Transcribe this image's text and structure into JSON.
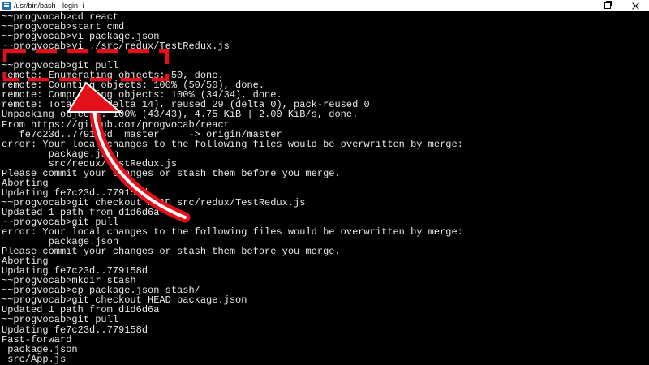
{
  "window": {
    "title": "/usr/bin/bash --login -i"
  },
  "terminal": {
    "lines": [
      "~~progvocab>cd react",
      "~~progvocab>start cmd",
      "~~progvocab>vi package.json",
      "~~progvocab>vi ./src/redux/TestRedux.js",
      "",
      "~~progvocab>git pull",
      "remote: Enumerating objects: 50, done.",
      "remote: Counting objects: 100% (50/50), done.",
      "remote: Compressing objects: 100% (34/34), done.",
      "remote: Total 43 (delta 14), reused 29 (delta 0), pack-reused 0",
      "Unpacking objects: 100% (43/43), 4.75 KiB | 2.00 KiB/s, done.",
      "From https://github.com/progvocab/react",
      "   fe7c23d..779158d  master     -> origin/master",
      "error: Your local changes to the following files would be overwritten by merge:",
      "        package.json",
      "        src/redux/TestRedux.js",
      "Please commit your changes or stash them before you merge.",
      "Aborting",
      "Updating fe7c23d..779158d",
      "~~progvocab>git checkout HEAD src/redux/TestRedux.js",
      "Updated 1 path from d1d6d6a",
      "~~progvocab>git pull",
      "error: Your local changes to the following files would be overwritten by merge:",
      "        package.json",
      "Please commit your changes or stash them before you merge.",
      "Aborting",
      "Updating fe7c23d..779158d",
      "~~progvocab>mkdir stash",
      "~~progvocab>cp package.json stash/",
      "~~progvocab>git checkout HEAD package.json",
      "Updated 1 path from d1d6d6a",
      "~~progvocab>git pull",
      "Updating fe7c23d..779158d",
      "Fast-forward",
      " package.json",
      " src/App.js"
    ]
  },
  "annotation": {
    "highlight_color": "#e3101a",
    "arrow_color": "#e3101a"
  }
}
